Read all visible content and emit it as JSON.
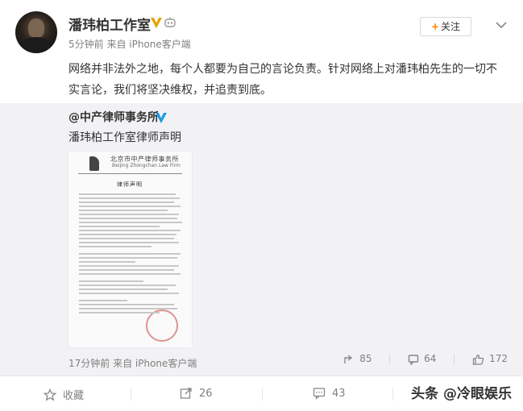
{
  "post": {
    "author": "潘玮柏工作室",
    "meta": "5分钟前 来自 iPhone客户端",
    "follow_label": "关注",
    "content": "网络并非法外之地，每个人都要为自己的言论负责。针对网络上对潘玮柏先生的一切不实言论，我们将坚决维权，并追责到底。"
  },
  "repost": {
    "author": "@中产律师事务所",
    "text": "潘玮柏工作室律师声明",
    "meta": "17分钟前 来自 iPhone客户端",
    "stats": {
      "reposts": "85",
      "comments": "64",
      "likes": "172"
    },
    "document": {
      "firm_name": "北京市中产律师事务所",
      "firm_name_en": "Beijing Zhongchan Law Firm",
      "title": "律师声明"
    }
  },
  "actions": {
    "favorite_label": "收藏",
    "repost_count": "26",
    "comment_count": "43"
  },
  "watermark": "头条 @冷眼娱乐",
  "colors": {
    "accent": "#ff8200",
    "vip": "#e6a200"
  }
}
